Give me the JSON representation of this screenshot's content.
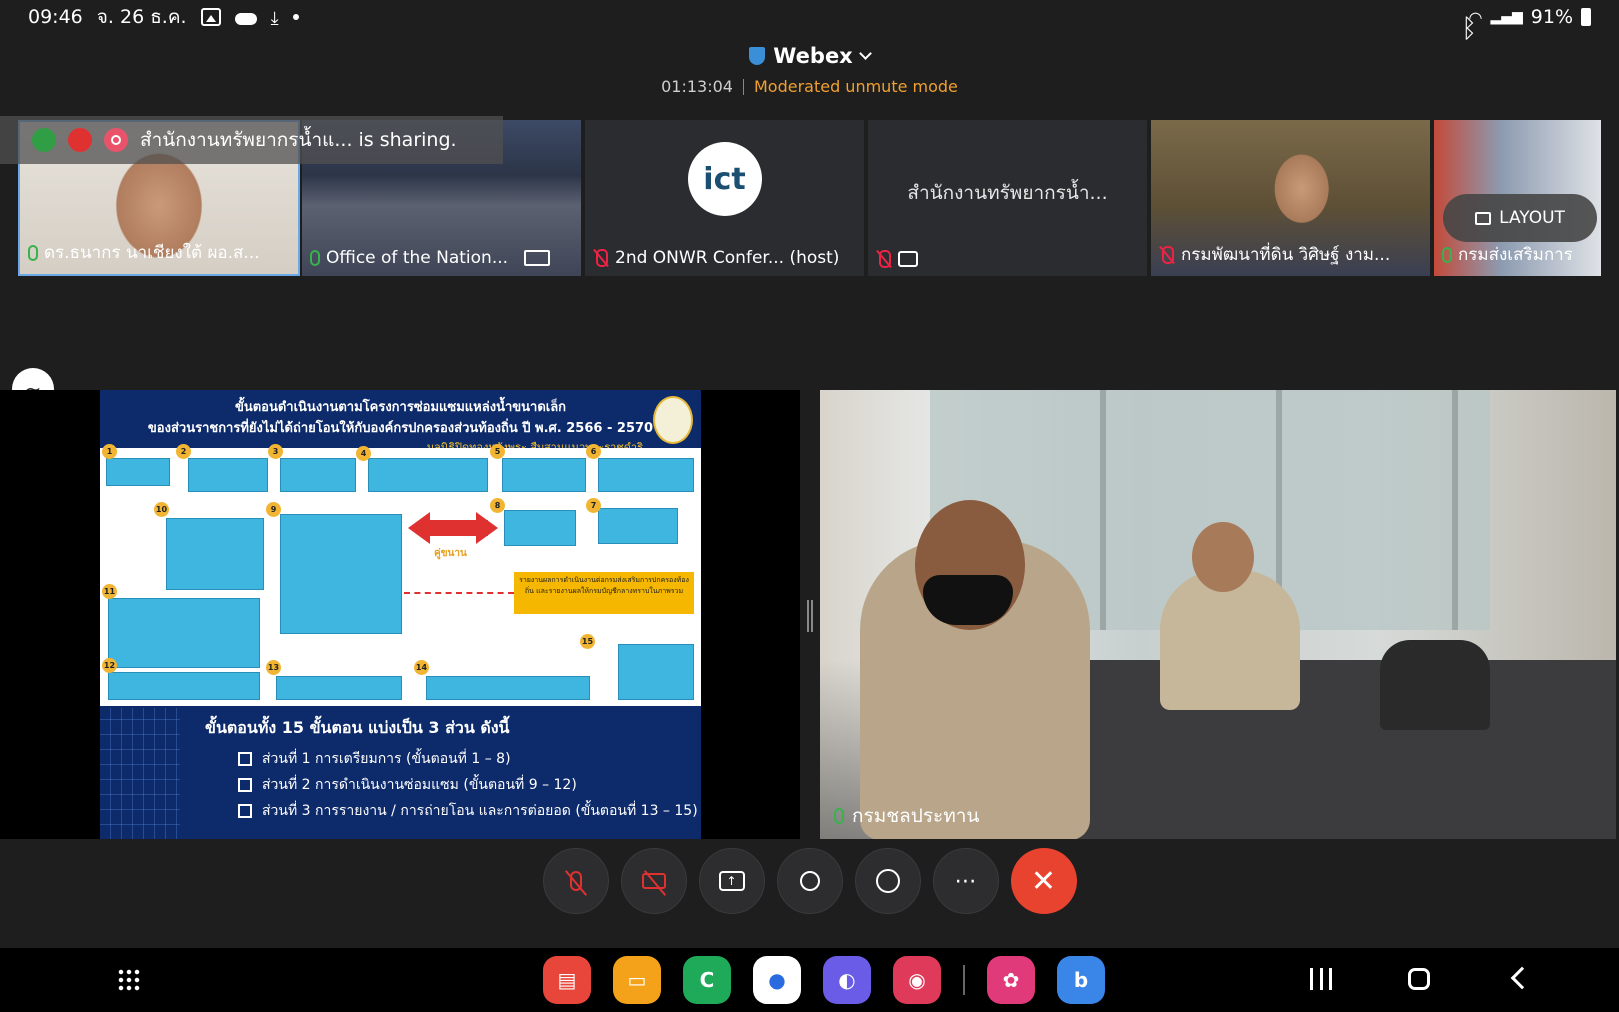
{
  "status_bar": {
    "time": "09:46",
    "date": "จ. 26 ธ.ค.",
    "battery": "91%"
  },
  "header": {
    "app_name": "Webex",
    "elapsed": "01:13:04",
    "mode": "Moderated unmute mode"
  },
  "sharing_banner": {
    "text": "สำนักงานทรัพยากรน้ำแ... is sharing."
  },
  "layout_button": "LAYOUT",
  "thumbnails": [
    {
      "name": "ดร.ธนากร นาเชียงใต้ ผอ.ส...",
      "mic": "on"
    },
    {
      "name": "Office of the Nation...",
      "mic": "on"
    },
    {
      "name": "2nd ONWR Confer... (host)",
      "mic": "off",
      "logo": "ict"
    },
    {
      "name": "สำนักงานทรัพยากรน้ำ...",
      "mic": "off"
    },
    {
      "name": "กรมพัฒนาที่ดิน วิศิษฐ์ งาม...",
      "mic": "off"
    },
    {
      "name": "กรมส่งเสริมการ",
      "mic": "on"
    }
  ],
  "slide": {
    "title_line1": "ขั้นตอนดำเนินงานตามโครงการซ่อมแซมแหล่งน้ำขนาดเล็ก",
    "title_line2": "ของส่วนราชการที่ยังไม่ได้ถ่ายโอนให้กับองค์กรปกครองส่วนท้องถิ่น ปี พ.ศ. 2566 - 2570",
    "title_line3": "มูลนิธิปิดทองหลังพระ สืบสานแนวพระราชดำริ",
    "partner_label": "คู่ขนาน",
    "yellow_box": "รายงานผลการดำเนินงานต่อกรมส่งเสริมการปกครองท้องถิ่น และรายงานผลให้กรมบัญชีกลางทราบในภาพรวม",
    "step_numbers": [
      "1",
      "2",
      "3",
      "4",
      "5",
      "6",
      "7",
      "8",
      "9",
      "10",
      "11",
      "12",
      "13",
      "14",
      "15"
    ],
    "summary_title": "ขั้นตอนทั้ง 15 ขั้นตอน แบ่งเป็น 3 ส่วน ดังนี้",
    "summary_items": [
      "ส่วนที่ 1 การเตรียมการ (ขั้นตอนที่ 1 – 8)",
      "ส่วนที่ 2 การดำเนินงานซ่อมแซม (ขั้นตอนที่ 9 – 12)",
      "ส่วนที่ 3 การรายงาน / การถ่ายโอน และการต่อยอด (ขั้นตอนที่ 13 – 15)"
    ]
  },
  "main_video": {
    "name": "กรมชลประทาน"
  },
  "controls": {
    "more": "⋯",
    "end": "✕"
  },
  "colors": {
    "background": "#1e1e1e",
    "mode_orange": "#f0a030",
    "mic_green": "#37b24d",
    "mute_red": "#e03131",
    "end_call": "#e8432e"
  }
}
